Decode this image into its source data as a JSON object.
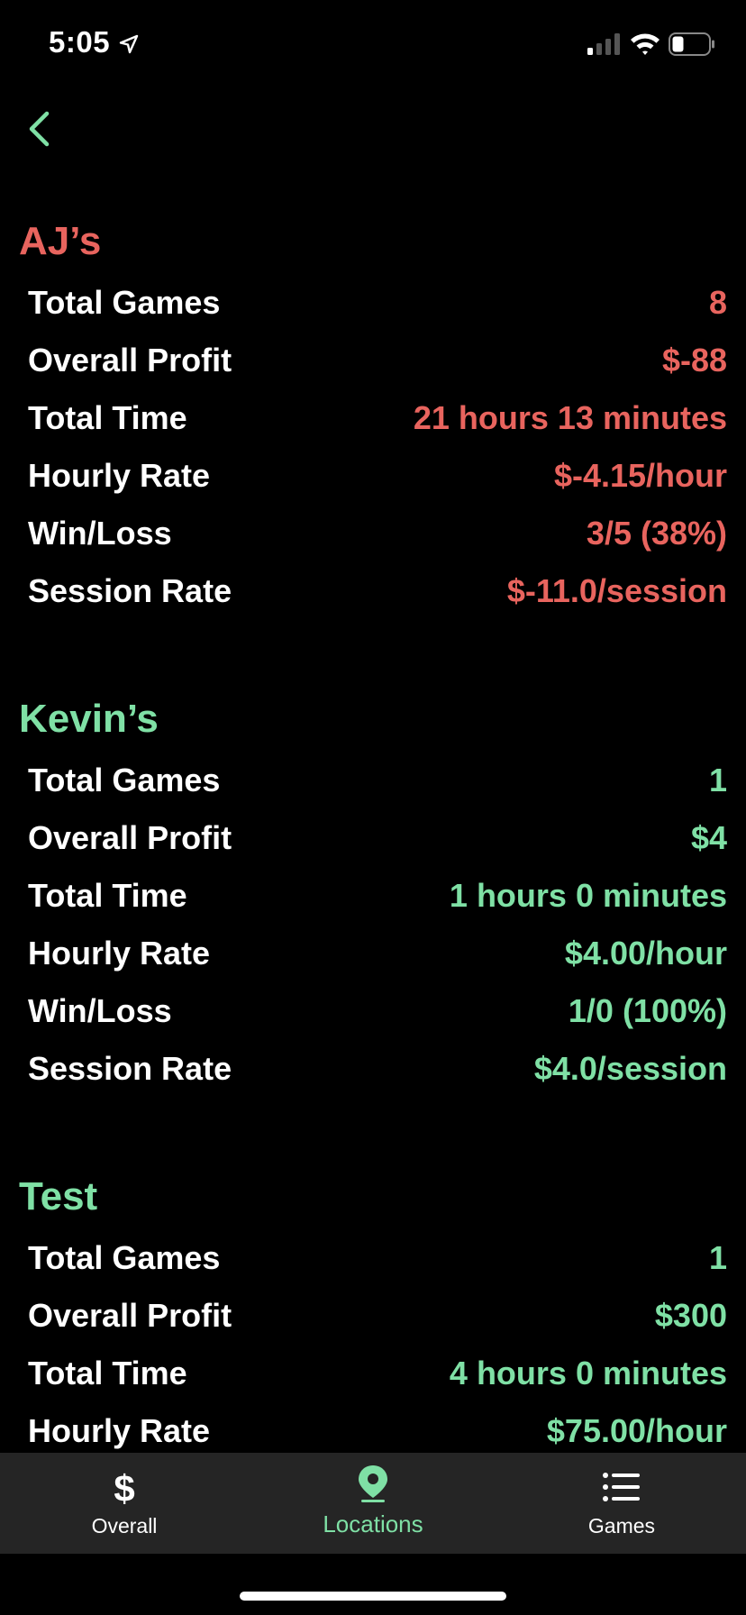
{
  "status_bar": {
    "time": "5:05"
  },
  "colors": {
    "negative": "#e8645e",
    "positive": "#7fe0a5",
    "tab_bar_bg": "#252525"
  },
  "locations": [
    {
      "name": "AJ’s",
      "tone": "negative",
      "stats": [
        {
          "label": "Total Games",
          "value": "8"
        },
        {
          "label": "Overall Profit",
          "value": "$-88"
        },
        {
          "label": "Total Time",
          "value": "21 hours 13 minutes"
        },
        {
          "label": "Hourly Rate",
          "value": "$-4.15/hour"
        },
        {
          "label": "Win/Loss",
          "value": "3/5 (38%)"
        },
        {
          "label": "Session Rate",
          "value": "$-11.0/session"
        }
      ]
    },
    {
      "name": "Kevin’s",
      "tone": "positive",
      "stats": [
        {
          "label": "Total Games",
          "value": "1"
        },
        {
          "label": "Overall Profit",
          "value": "$4"
        },
        {
          "label": "Total Time",
          "value": "1 hours 0 minutes"
        },
        {
          "label": "Hourly Rate",
          "value": "$4.00/hour"
        },
        {
          "label": "Win/Loss",
          "value": "1/0 (100%)"
        },
        {
          "label": "Session Rate",
          "value": "$4.0/session"
        }
      ]
    },
    {
      "name": "Test",
      "tone": "positive",
      "stats": [
        {
          "label": "Total Games",
          "value": "1"
        },
        {
          "label": "Overall Profit",
          "value": "$300"
        },
        {
          "label": "Total Time",
          "value": "4 hours 0 minutes"
        },
        {
          "label": "Hourly Rate",
          "value": "$75.00/hour"
        }
      ]
    }
  ],
  "tab_bar": {
    "tabs": [
      {
        "label": "Overall",
        "icon": "dollar-icon",
        "active": false
      },
      {
        "label": "Locations",
        "icon": "map-pin-icon",
        "active": true
      },
      {
        "label": "Games",
        "icon": "list-icon",
        "active": false
      }
    ]
  }
}
